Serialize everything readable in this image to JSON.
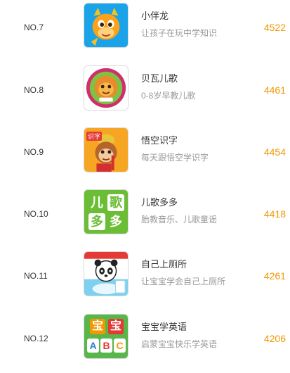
{
  "ranking": {
    "accent_color": "#f39800",
    "items": [
      {
        "rank": "NO.7",
        "name": "小伴龙",
        "desc": "让孩子在玩中学知识",
        "score": "4522",
        "icon": "dragon-app-icon"
      },
      {
        "rank": "NO.8",
        "name": "贝瓦儿歌",
        "desc": "0-8岁早教儿歌",
        "score": "4461",
        "icon": "beiwa-lion-app-icon"
      },
      {
        "rank": "NO.9",
        "name": "悟空识字",
        "desc": "每天跟悟空学识字",
        "score": "4454",
        "icon": "monkey-king-app-icon"
      },
      {
        "rank": "NO.10",
        "name": "儿歌多多",
        "desc": "胎教音乐、儿歌童谣",
        "score": "4418",
        "icon": "erge-duoduo-app-icon"
      },
      {
        "rank": "NO.11",
        "name": "自己上厕所",
        "desc": "让宝宝学会自己上厕所",
        "score": "4261",
        "icon": "panda-toilet-app-icon"
      },
      {
        "rank": "NO.12",
        "name": "宝宝学英语",
        "desc": "启蒙宝宝快乐学英语",
        "score": "4206",
        "icon": "abc-blocks-app-icon"
      }
    ],
    "icon_texts": {
      "wukong_badge": "识字",
      "erge": [
        "儿",
        "歌",
        "多",
        "多"
      ],
      "baobao": [
        "宝",
        "宝"
      ],
      "abc": [
        "A",
        "B",
        "C"
      ]
    }
  }
}
